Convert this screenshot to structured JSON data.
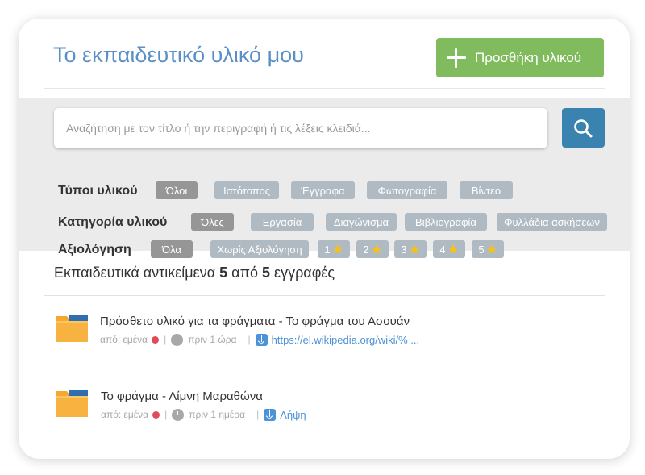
{
  "header": {
    "title": "Το εκπαιδευτικό υλικό μου",
    "add_button_label": "Προσθήκη υλικού"
  },
  "search": {
    "placeholder": "Αναζήτηση με τον τίτλο ή την περιγραφή ή τις λέξεις κλειδιά..."
  },
  "filters": {
    "types": {
      "label": "Τύποι υλικού",
      "options": [
        "Όλοι",
        "Ιστότοπος",
        "Έγγραφα",
        "Φωτογραφία",
        "Βίντεο"
      ],
      "selected": "Όλοι"
    },
    "category": {
      "label": "Κατηγορία υλικού",
      "options": [
        "Όλες",
        "Εργασία",
        "Διαγώνισμα",
        "Βιβλιογραφία",
        "Φυλλάδια ασκήσεων"
      ],
      "selected": "Όλες"
    },
    "rating": {
      "label": "Αξιολόγηση",
      "options": [
        "Όλα",
        "Χωρίς Αξιολόγηση",
        "1",
        "2",
        "3",
        "4",
        "5"
      ],
      "selected": "Όλα"
    }
  },
  "results": {
    "prefix": "Εκπαιδευτικά αντικείμενα",
    "shown": "5",
    "middle": "από",
    "total": "5",
    "suffix": "εγγραφές"
  },
  "items": [
    {
      "title": "Πρόσθετο υλικό για τα φράγματα - Το φράγμα του Ασουάν",
      "author": "από: εμένα",
      "time": "πριν 1 ώρα",
      "link": "https://el.wikipedia.org/wiki/% ..."
    },
    {
      "title": "Το φράγμα - Λίμνη Μαραθώνα",
      "author": "από: εμένα",
      "time": "πριν 1 ημέρα",
      "link": "Λήψη"
    }
  ],
  "colors": {
    "title_blue": "#5b8fc6",
    "add_green": "#80bb5e",
    "search_blue": "#3a83b0",
    "chip_gray": "#b0bac2",
    "chip_active": "#969696",
    "link_blue": "#4b92d6",
    "author_dot": "#e24a5b",
    "folder_orange": "#f6a72e"
  },
  "icons": [
    "plus-icon",
    "search-icon",
    "star-icon",
    "folder-icon",
    "clock-icon",
    "download-icon"
  ]
}
